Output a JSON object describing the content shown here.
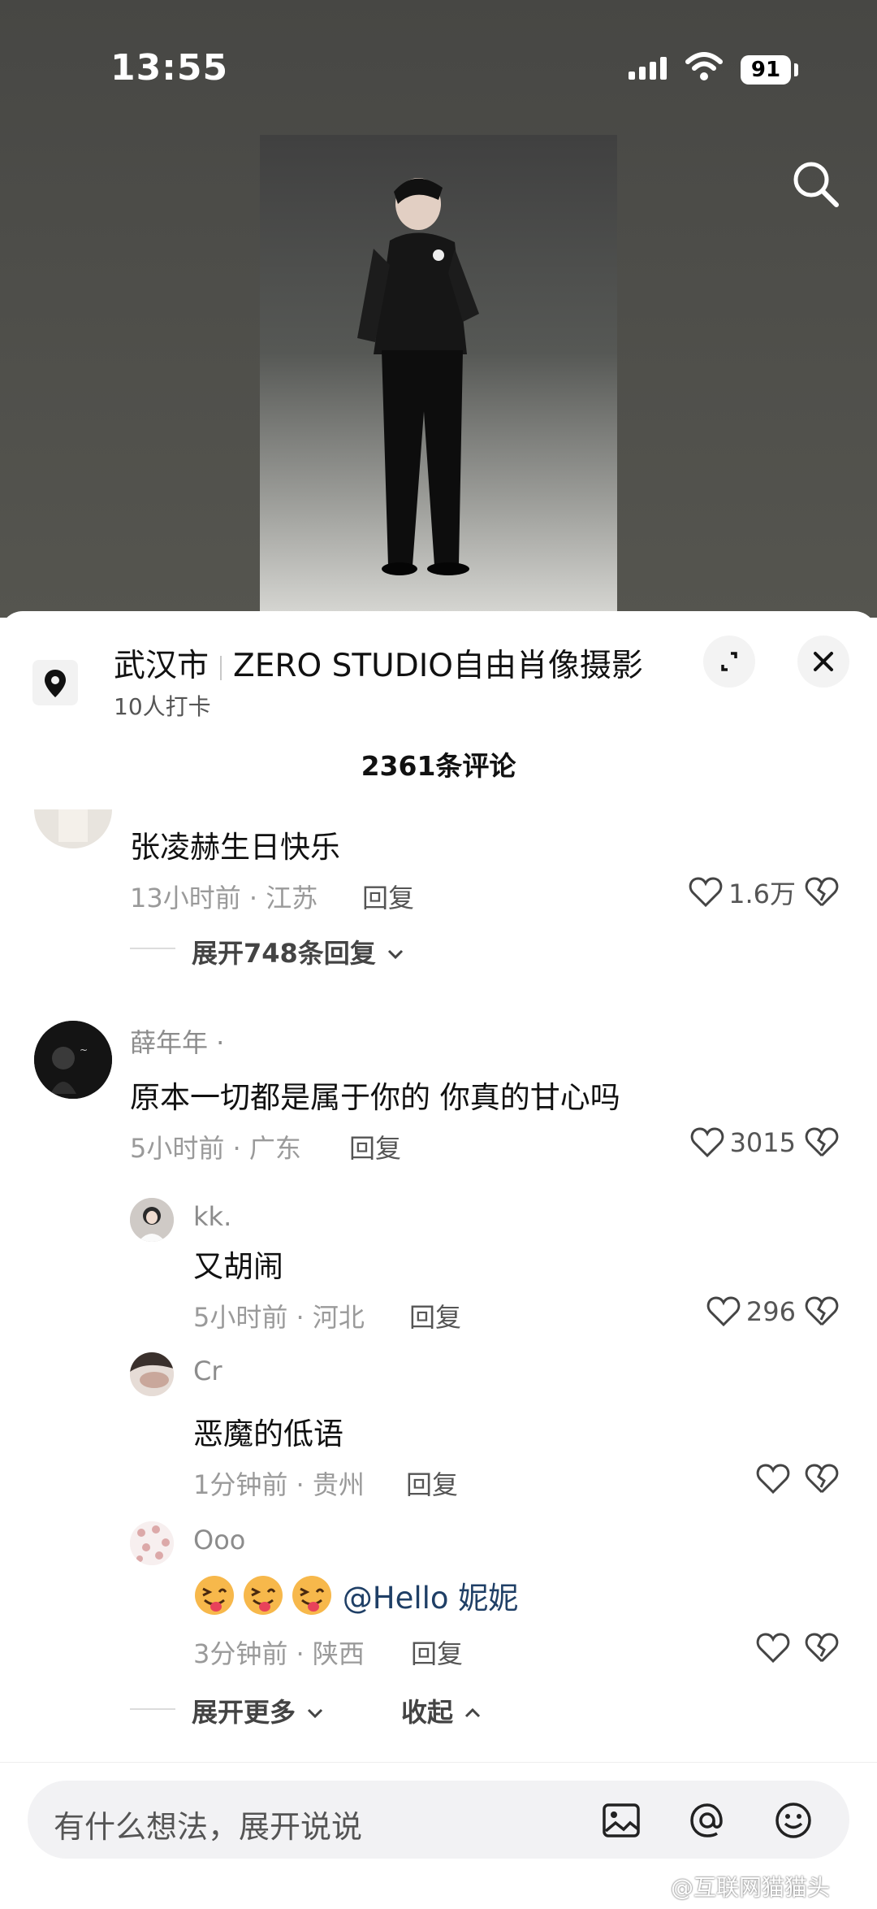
{
  "status_bar": {
    "time": "13:55",
    "battery": "91"
  },
  "location": {
    "city": "武汉市",
    "name": "ZERO STUDIO自由肖像摄影",
    "checkins": "10人打卡"
  },
  "comment_count": "2361条评论",
  "comments": [
    {
      "text": "张凌赫生日快乐",
      "time_place": "13小时前 · 江苏",
      "reply_label": "回复",
      "likes": "1.6万",
      "expand_label": "展开748条回复"
    },
    {
      "name": "薛年年 ·",
      "text": "原本一切都是属于你的 你真的甘心吗",
      "time_place": "5小时前 · 广东",
      "reply_label": "回复",
      "likes": "3015",
      "replies": [
        {
          "name": "kk.",
          "text": "又胡闹",
          "time_place": "5小时前 · 河北",
          "reply_label": "回复",
          "likes": "296"
        },
        {
          "name": "Cr",
          "text": "恶魔的低语",
          "time_place": "1分钟前 · 贵州",
          "reply_label": "回复",
          "likes": ""
        },
        {
          "name": "Ooo",
          "text": "@Hello 妮妮",
          "time_place": "3分钟前 · 陕西",
          "reply_label": "回复",
          "likes": ""
        }
      ],
      "expand_more_label": "展开更多",
      "collapse_label": "收起"
    }
  ],
  "input": {
    "placeholder": "有什么想法，展开说说"
  },
  "watermark": "@互联网猫猫头",
  "icons": [
    "search-icon",
    "location-pin-icon",
    "expand-icon",
    "close-icon",
    "heart-icon",
    "broken-heart-icon",
    "image-icon",
    "at-icon",
    "emoji-icon",
    "chevron-down-icon",
    "chevron-up-icon"
  ]
}
